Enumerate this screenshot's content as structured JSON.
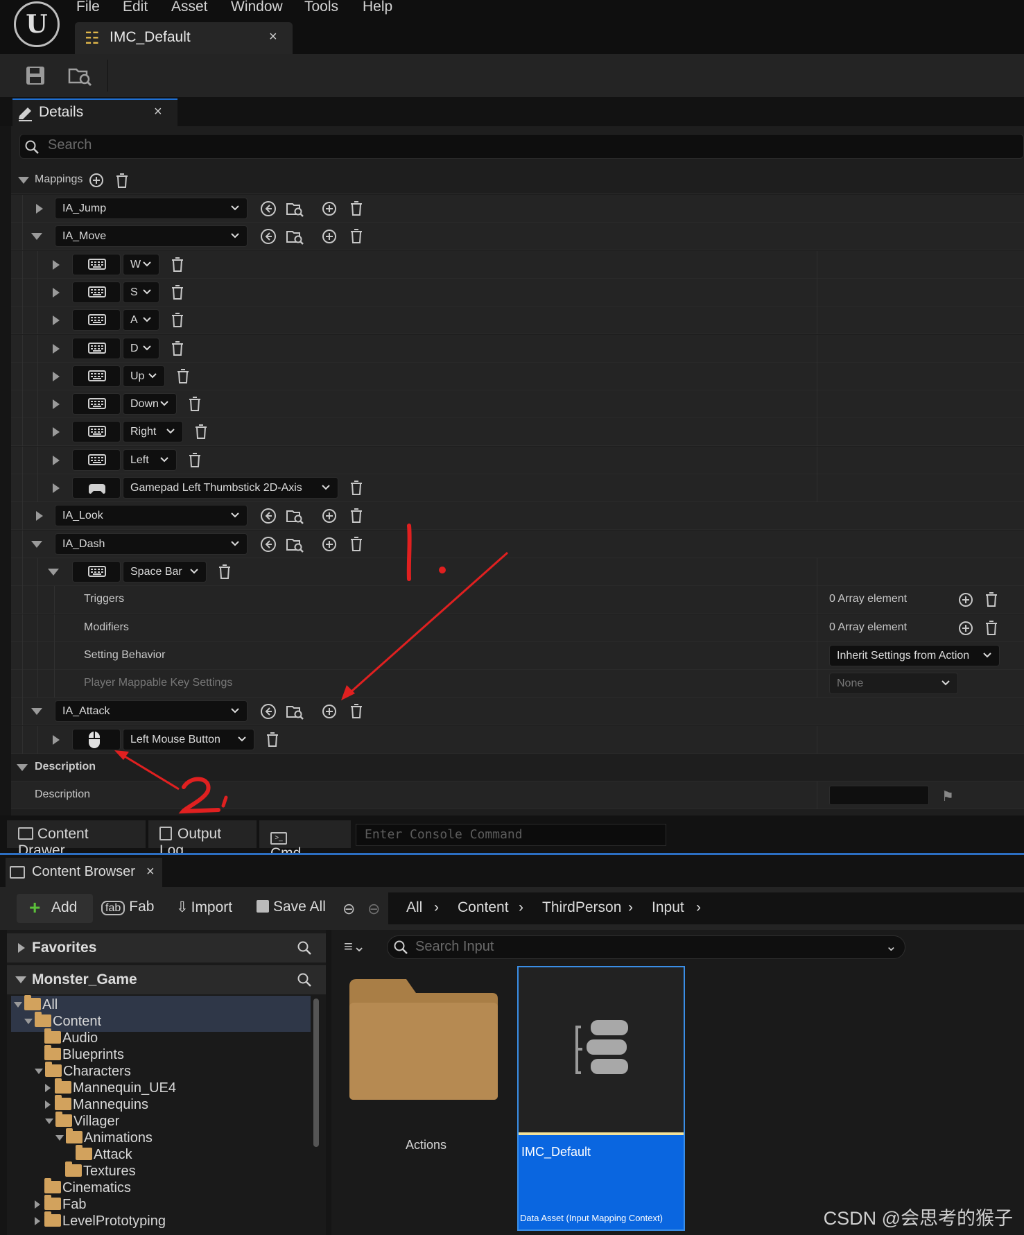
{
  "app": {
    "logo_glyph": "U"
  },
  "menu": {
    "items": [
      "File",
      "Edit",
      "Asset",
      "Window",
      "Tools",
      "Help"
    ]
  },
  "document_tab": {
    "title": "IMC_Default",
    "close": "×"
  },
  "details": {
    "tab_label": "Details",
    "close": "×",
    "search_placeholder": "Search",
    "mappings_label": "Mappings",
    "actions": [
      {
        "name": "IA_Jump",
        "expanded": false
      },
      {
        "name": "IA_Move",
        "expanded": true,
        "keys": [
          "W",
          "S",
          "A",
          "D",
          "Up",
          "Down",
          "Right",
          "Left",
          "Gamepad Left Thumbstick 2D-Axis"
        ]
      },
      {
        "name": "IA_Look",
        "expanded": false
      },
      {
        "name": "IA_Dash",
        "expanded": true,
        "keys": [
          "Space Bar"
        ]
      },
      {
        "name": "IA_Attack",
        "expanded": true,
        "keys": [
          "Left Mouse Button"
        ]
      }
    ],
    "dash_props": {
      "triggers_label": "Triggers",
      "triggers_value": "0 Array element",
      "modifiers_label": "Modifiers",
      "modifiers_value": "0 Array element",
      "setting_behavior_label": "Setting Behavior",
      "setting_behavior_value": "Inherit Settings from Action",
      "player_mappable_label": "Player Mappable Key Settings",
      "player_mappable_value": "None"
    },
    "description_section": "Description",
    "description_label": "Description"
  },
  "annotations": {
    "one": "1.",
    "two": "2.",
    "color": "#e02020"
  },
  "bottom_bar": {
    "content_drawer": "Content Drawer",
    "output_log": "Output Log",
    "cmd": "Cmd",
    "console_placeholder": "Enter Console Command"
  },
  "content_browser": {
    "tab_label": "Content Browser",
    "close": "×",
    "add": "Add",
    "fab": "Fab",
    "import": "Import",
    "save_all": "Save All",
    "breadcrumb": [
      "All",
      "Content",
      "ThirdPerson",
      "Input"
    ],
    "favorites": "Favorites",
    "project": "Monster_Game",
    "tree": [
      "All",
      "Content",
      "Audio",
      "Blueprints",
      "Characters",
      "Mannequin_UE4",
      "Mannequins",
      "Villager",
      "Animations",
      "Attack",
      "Textures",
      "Cinematics",
      "Fab",
      "LevelPrototyping"
    ],
    "search_placeholder": "Search Input",
    "assets": [
      {
        "name": "Actions"
      },
      {
        "name": "IMC_Default",
        "type": "Data Asset (Input Mapping Context)"
      }
    ]
  },
  "watermark": "CSDN @会思考的猴子"
}
